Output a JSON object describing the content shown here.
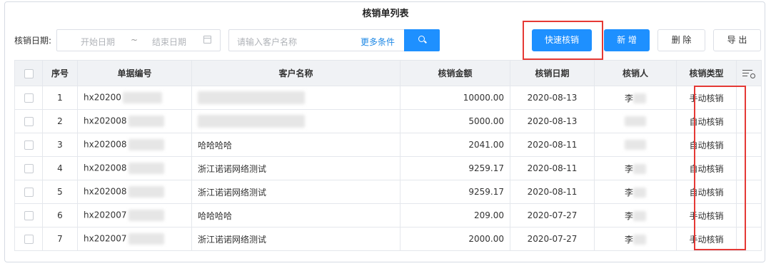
{
  "page": {
    "title": "核销单列表"
  },
  "filters": {
    "date_label": "核销日期:",
    "date_start_placeholder": "开始日期",
    "date_separator": "~",
    "date_end_placeholder": "结束日期",
    "customer_placeholder": "请输入客户名称",
    "more_conditions": "更多条件"
  },
  "actions": {
    "quick_writeoff": "快速核销",
    "add": "新 增",
    "delete": "删 除",
    "export": "导 出"
  },
  "table": {
    "columns": [
      "序号",
      "单据编号",
      "客户名称",
      "核销金额",
      "核销日期",
      "核销人",
      "核销类型"
    ],
    "rows": [
      {
        "index": "1",
        "doc_no": "hx20200",
        "customer": "",
        "amount": "10000.00",
        "date": "2020-08-13",
        "user": "李",
        "type": "手动核销"
      },
      {
        "index": "2",
        "doc_no": "hx202008",
        "customer": "",
        "amount": "5000.00",
        "date": "2020-08-13",
        "user": "",
        "type": "自动核销"
      },
      {
        "index": "3",
        "doc_no": "hx202008",
        "customer": "哈哈哈哈",
        "amount": "2041.00",
        "date": "2020-08-11",
        "user": "",
        "type": "自动核销"
      },
      {
        "index": "4",
        "doc_no": "hx202008",
        "customer": "浙江诺诺网络测试",
        "amount": "9259.17",
        "date": "2020-08-11",
        "user": "李",
        "type": "自动核销"
      },
      {
        "index": "5",
        "doc_no": "hx202008",
        "customer": "浙江诺诺网络测试",
        "amount": "9259.17",
        "date": "2020-08-11",
        "user": "李",
        "type": "自动核销"
      },
      {
        "index": "6",
        "doc_no": "hx202007",
        "customer": "哈哈哈哈",
        "amount": "209.00",
        "date": "2020-07-27",
        "user": "李",
        "type": "手动核销"
      },
      {
        "index": "7",
        "doc_no": "hx202007",
        "customer": "浙江诺诺网络测试",
        "amount": "2000.00",
        "date": "2020-07-27",
        "user": "李",
        "type": "手动核销"
      }
    ]
  },
  "icons": {
    "search": "search-icon",
    "calendar": "calendar-icon",
    "column_settings": "column-settings-icon"
  },
  "colors": {
    "primary": "#1e90ff",
    "highlight": "#e53935",
    "header_bg": "#f0f2f5"
  }
}
